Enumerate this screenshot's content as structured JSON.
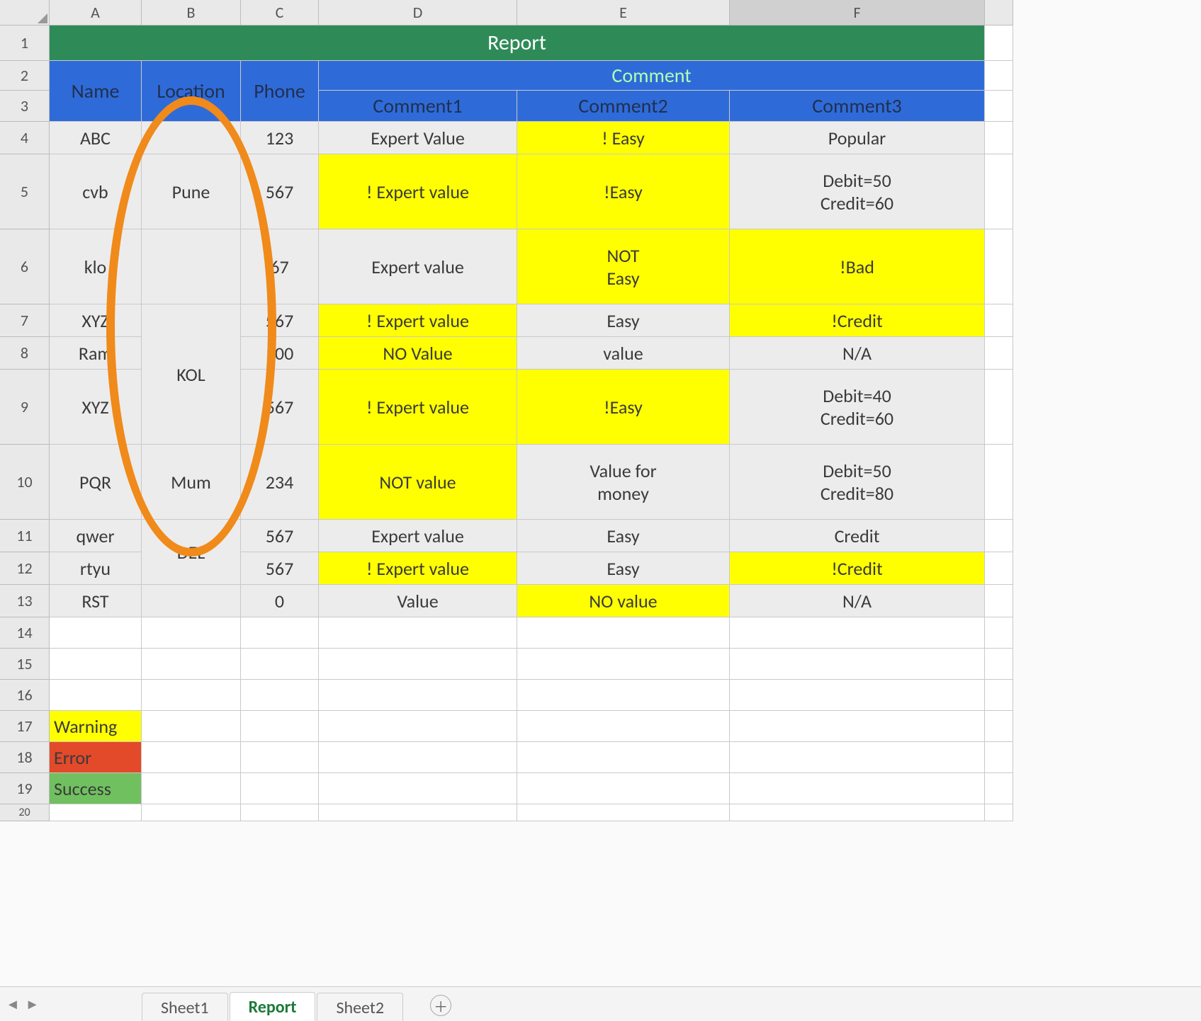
{
  "columns": [
    "A",
    "B",
    "C",
    "D",
    "E",
    "F"
  ],
  "activeColumn": "F",
  "rowLabels": [
    "1",
    "2",
    "3",
    "4",
    "5",
    "6",
    "7",
    "8",
    "9",
    "10",
    "11",
    "12",
    "13",
    "14",
    "15",
    "16",
    "17",
    "18",
    "19",
    "20"
  ],
  "header": {
    "reportTitle": "Report",
    "name": "Name",
    "location": "Location",
    "phone": "Phone",
    "commentGroup": "Comment",
    "comment1": "Comment1",
    "comment2": "Comment2",
    "comment3": "Comment3"
  },
  "rows": [
    {
      "name": "ABC",
      "location": "",
      "phone": "123",
      "c1": "Expert Value",
      "c2": "! Easy",
      "c3": "Popular",
      "hl": {
        "c2": "yellow"
      }
    },
    {
      "name": "cvb",
      "location": "Pune",
      "phone": "567",
      "c1": "! Expert value",
      "c2": "!Easy",
      "c3": "Debit=50\nCredit=60",
      "hl": {
        "c1": "yellow",
        "c2": "yellow"
      }
    },
    {
      "name": "klo",
      "location": "",
      "phone": "67",
      "c1": "Expert value",
      "c2": "NOT\nEasy",
      "c3": "!Bad",
      "hl": {
        "c2": "yellow",
        "c3": "yellow"
      }
    },
    {
      "name": "XYZ",
      "location": "KOL",
      "phone": "567",
      "c1": "! Expert value",
      "c2": "Easy",
      "c3": "!Credit",
      "hl": {
        "c1": "yellow",
        "c3": "yellow"
      }
    },
    {
      "name": "Ram",
      "location": "",
      "phone": "100",
      "c1": "NO Value",
      "c2": "value",
      "c3": "N/A",
      "hl": {
        "c1": "yellow"
      }
    },
    {
      "name": "XYZ",
      "location": "",
      "phone": "567",
      "c1": "! Expert value",
      "c2": "!Easy",
      "c3": "Debit=40\nCredit=60",
      "hl": {
        "c1": "yellow",
        "c2": "yellow"
      }
    },
    {
      "name": "PQR",
      "location": "Mum",
      "phone": "234",
      "c1": "NOT value",
      "c2": "Value for\nmoney",
      "c3": "Debit=50\nCredit=80",
      "hl": {
        "c1": "yellow"
      }
    },
    {
      "name": "qwer",
      "location": "",
      "phone": "567",
      "c1": "Expert value",
      "c2": "Easy",
      "c3": "Credit",
      "hl": {}
    },
    {
      "name": "rtyu",
      "location": "DEL",
      "phone": "567",
      "c1": "! Expert value",
      "c2": "Easy",
      "c3": "!Credit",
      "hl": {
        "c1": "yellow",
        "c3": "yellow"
      }
    },
    {
      "name": "RST",
      "location": "",
      "phone": "0",
      "c1": "Value",
      "c2": "NO value",
      "c3": "N/A",
      "hl": {
        "c2": "yellow"
      }
    }
  ],
  "locationMerges": [
    {
      "startRow": 0,
      "span": 1,
      "text": ""
    },
    {
      "startRow": 1,
      "span": 1,
      "text": "Pune"
    },
    {
      "startRow": 2,
      "span": 1,
      "text": ""
    },
    {
      "startRow": 3,
      "span": 3,
      "text": "KOL"
    },
    {
      "startRow": 6,
      "span": 1,
      "text": "Mum"
    },
    {
      "startRow": 7,
      "span": 2,
      "text": "DEL"
    },
    {
      "startRow": 9,
      "span": 1,
      "text": ""
    }
  ],
  "legend": {
    "warning": "Warning",
    "error": "Error",
    "success": "Success"
  },
  "tabs": [
    "Sheet1",
    "Report",
    "Sheet2"
  ],
  "activeTab": "Report",
  "chart_data": {
    "type": "table",
    "title": "Report",
    "columns": [
      "Name",
      "Location",
      "Phone",
      "Comment1",
      "Comment2",
      "Comment3"
    ],
    "rows": [
      [
        "ABC",
        "",
        "123",
        "Expert Value",
        "! Easy",
        "Popular"
      ],
      [
        "cvb",
        "Pune",
        "567",
        "! Expert value",
        "!Easy",
        "Debit=50 / Credit=60"
      ],
      [
        "klo",
        "",
        "67",
        "Expert value",
        "NOT Easy",
        "!Bad"
      ],
      [
        "XYZ",
        "KOL",
        "567",
        "! Expert value",
        "Easy",
        "!Credit"
      ],
      [
        "Ram",
        "KOL",
        "100",
        "NO Value",
        "value",
        "N/A"
      ],
      [
        "XYZ",
        "KOL",
        "567",
        "! Expert value",
        "!Easy",
        "Debit=40 / Credit=60"
      ],
      [
        "PQR",
        "Mum",
        "234",
        "NOT value",
        "Value for money",
        "Debit=50 / Credit=80"
      ],
      [
        "qwer",
        "DEL",
        "567",
        "Expert value",
        "Easy",
        "Credit"
      ],
      [
        "rtyu",
        "DEL",
        "567",
        "! Expert value",
        "Easy",
        "!Credit"
      ],
      [
        "RST",
        "",
        "0",
        "Value",
        "NO value",
        "N/A"
      ]
    ]
  }
}
